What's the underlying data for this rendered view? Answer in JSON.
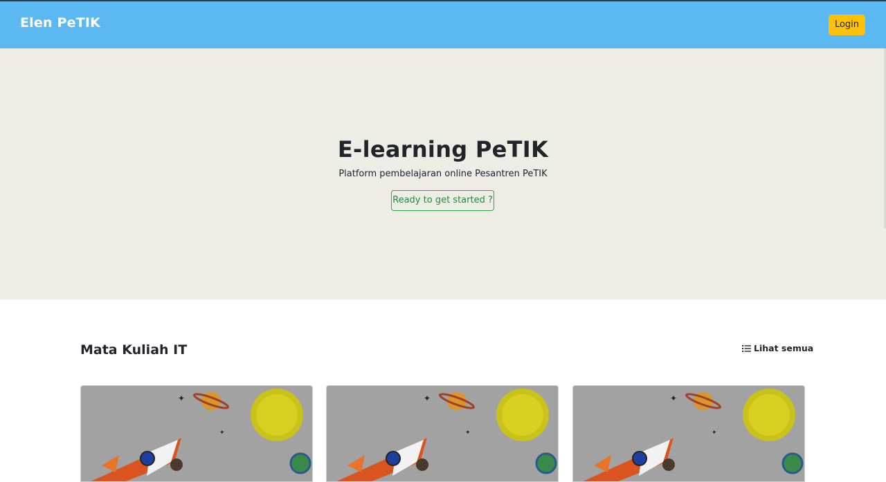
{
  "navbar": {
    "brand": "Elen PeTIK",
    "login_label": "Login"
  },
  "hero": {
    "title": "E-learning PeTIK",
    "subtitle": "Platform pembelajaran online Pesantren PeTIK",
    "cta_label": "Ready to get started ?"
  },
  "courses": {
    "title": "Mata Kuliah IT",
    "see_all_label": "Lihat semua",
    "see_all_icon": "list-icon",
    "cards": [
      {
        "image": "rocket-space-illustration"
      },
      {
        "image": "rocket-space-illustration"
      },
      {
        "image": "rocket-space-illustration"
      }
    ]
  },
  "colors": {
    "navbar": "#5cb8f0",
    "login_button": "#ffc107",
    "hero_bg": "#edede6",
    "cta_border": "#28a745"
  }
}
